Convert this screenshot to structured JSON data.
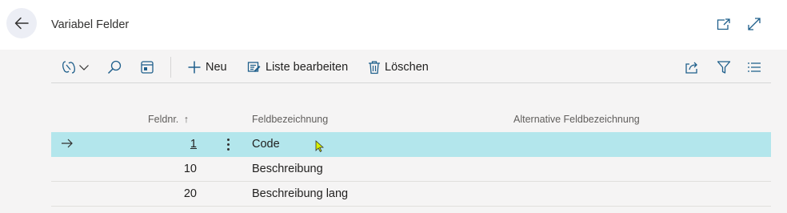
{
  "page": {
    "title": "Variabel Felder"
  },
  "header": {
    "back_icon": "arrow-left-icon",
    "open_new_icon": "open-in-new-window-icon",
    "expand_icon": "expand-diagonal-icon"
  },
  "toolbar": {
    "new_label": "Neu",
    "edit_list_label": "Liste bearbeiten",
    "delete_label": "Löschen",
    "icons": [
      "copilot-icon",
      "chevron-down-icon",
      "search-icon",
      "layout-icon",
      "plus-icon",
      "edit-list-icon",
      "trash-icon",
      "share-icon",
      "filter-icon",
      "list-view-icon"
    ]
  },
  "grid": {
    "columns": {
      "number": "Feldnr.",
      "number_sort": "↑",
      "name": "Feldbezeichnung",
      "alt_name": "Alternative Feldbezeichnung"
    },
    "rows": [
      {
        "number": "1",
        "name": "Code",
        "alt_name": "",
        "selected": true
      },
      {
        "number": "10",
        "name": "Beschreibung",
        "alt_name": "",
        "selected": false
      },
      {
        "number": "20",
        "name": "Beschreibung lang",
        "alt_name": "",
        "selected": false
      }
    ]
  },
  "colors": {
    "selected_row": "#b3e6ec",
    "accent": "#0078d4",
    "page_bg": "#f5f4f4"
  }
}
